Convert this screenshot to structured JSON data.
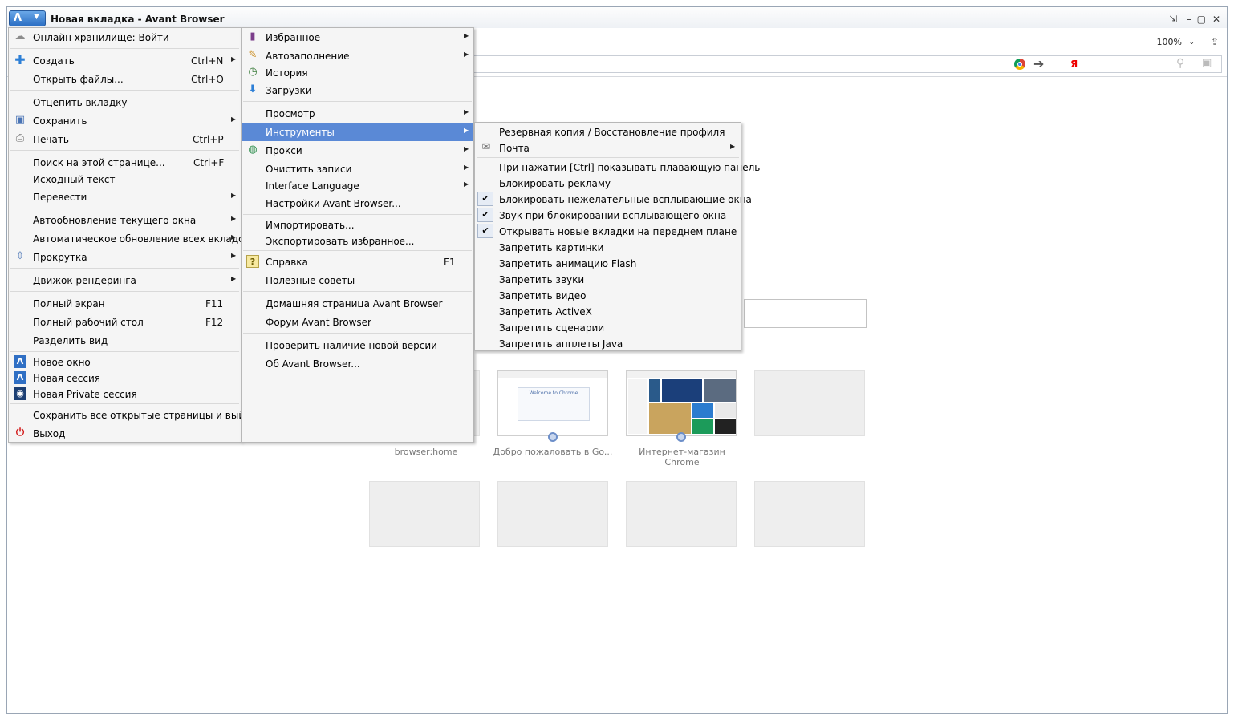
{
  "window": {
    "title": "Новая вкладка - Avant Browser",
    "zoom": "100%",
    "zoom_drop": "⌄",
    "controls": [
      "⇲",
      "–",
      "▢",
      "✕"
    ]
  },
  "speed_dial": {
    "labels": [
      "browser:home",
      "Добро пожаловать в Go...",
      "Интернет-магазин Chrome"
    ],
    "welcome_text": "Welcome to Chrome"
  },
  "main_menu": [
    {
      "label": "Онлайн хранилище: Войти",
      "shortcut": "",
      "icon": "cloud-icon"
    },
    {
      "label": "Создать",
      "shortcut": "Ctrl+N",
      "icon": "plus-icon",
      "submenu": true
    },
    {
      "label": "Открыть файлы...",
      "shortcut": "Ctrl+O"
    },
    {
      "label": "Отцепить вкладку",
      "shortcut": ""
    },
    {
      "label": "Сохранить",
      "shortcut": "",
      "icon": "floppy-icon",
      "submenu": true
    },
    {
      "label": "Печать",
      "shortcut": "Ctrl+P",
      "icon": "printer-icon"
    },
    {
      "label": "Поиск на этой странице...",
      "shortcut": "Ctrl+F"
    },
    {
      "label": "Исходный текст",
      "shortcut": ""
    },
    {
      "label": "Перевести",
      "shortcut": "",
      "submenu": true
    },
    {
      "label": "Автообновление текущего окна",
      "shortcut": "",
      "submenu": true
    },
    {
      "label": "Автоматическое обновление всех вкладок",
      "shortcut": "",
      "submenu": true
    },
    {
      "label": "Прокрутка",
      "shortcut": "",
      "icon": "scroll-icon",
      "submenu": true
    },
    {
      "label": "Движок рендеринга",
      "shortcut": "",
      "submenu": true
    },
    {
      "label": "Полный экран",
      "shortcut": "F11"
    },
    {
      "label": "Полный рабочий стол",
      "shortcut": "F12"
    },
    {
      "label": "Разделить вид",
      "shortcut": ""
    },
    {
      "label": "Новое окно",
      "shortcut": "",
      "icon": "avant-icon"
    },
    {
      "label": "Новая сессия",
      "shortcut": "",
      "icon": "avant-icon"
    },
    {
      "label": "Новая Private сессия",
      "shortcut": "",
      "icon": "private-icon"
    },
    {
      "label": "Сохранить все открытые страницы и выйти",
      "shortcut": ""
    },
    {
      "label": "Выход",
      "shortcut": "",
      "icon": "power-icon"
    }
  ],
  "sub_menu": [
    {
      "label": "Избранное",
      "icon": "bookmark-icon",
      "submenu": true
    },
    {
      "label": "Автозаполнение",
      "icon": "autofill-icon",
      "submenu": true
    },
    {
      "label": "История",
      "icon": "history-icon"
    },
    {
      "label": "Загрузки",
      "icon": "download-icon"
    },
    {
      "label": "Просмотр",
      "submenu": true
    },
    {
      "label": "Инструменты",
      "submenu": true,
      "highlighted": true
    },
    {
      "label": "Прокси",
      "icon": "proxy-icon",
      "submenu": true
    },
    {
      "label": "Очистить записи",
      "submenu": true
    },
    {
      "label": "Interface Language",
      "submenu": true
    },
    {
      "label": "Настройки Avant Browser..."
    },
    {
      "label": "Импортировать..."
    },
    {
      "label": "Экспортировать избранное..."
    },
    {
      "label": "Справка",
      "shortcut": "F1",
      "icon": "help-icon"
    },
    {
      "label": "Полезные советы"
    },
    {
      "label": "Домашняя страница Avant Browser"
    },
    {
      "label": "Форум Avant Browser"
    },
    {
      "label": "Проверить наличие новой версии"
    },
    {
      "label": "Об Avant Browser..."
    }
  ],
  "tools_menu": [
    {
      "label": "Резервная копия / Восстановление профиля"
    },
    {
      "label": "Почта",
      "icon": "mail-icon",
      "submenu": true
    },
    {
      "label": "При нажатии [Ctrl] показывать плавающую панель"
    },
    {
      "label": "Блокировать рекламу"
    },
    {
      "label": "Блокировать нежелательные всплывающие окна",
      "checked": true
    },
    {
      "label": "Звук при блокировании всплывающего окна",
      "checked": true
    },
    {
      "label": "Открывать новые вкладки на переднем плане",
      "checked": true
    },
    {
      "label": "Запретить картинки"
    },
    {
      "label": "Запретить анимацию Flash"
    },
    {
      "label": "Запретить звуки"
    },
    {
      "label": "Запретить видео"
    },
    {
      "label": "Запретить ActiveX"
    },
    {
      "label": "Запретить сценарии"
    },
    {
      "label": "Запретить апплеты Java"
    }
  ],
  "glyphs": {
    "arrow": "▶",
    "check": "✔"
  }
}
